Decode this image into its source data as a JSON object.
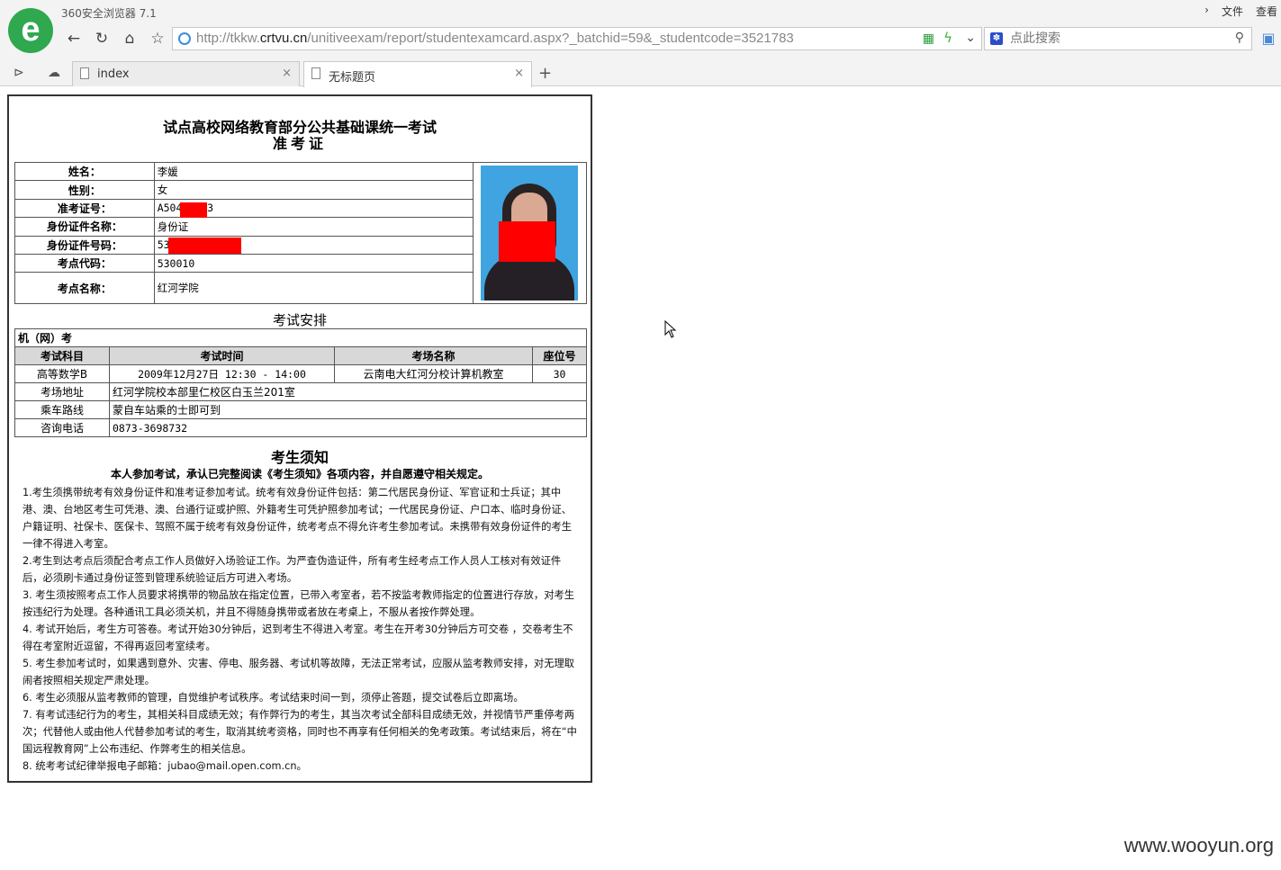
{
  "browser": {
    "app_title": "360安全浏览器 7.1",
    "menu": [
      "文件",
      "查看"
    ],
    "url_prefix": "http://tkkw.",
    "url_domain": "crtvu.cn",
    "url_path": "/unitiveexam/report/studentexamcard.aspx?_batchid=59&_studentcode=3521783",
    "search_placeholder": "点此搜索",
    "tabs": [
      {
        "label": "index"
      },
      {
        "label": "无标题页"
      }
    ]
  },
  "card": {
    "title1": "试点高校网络教育部分公共基础课统一考试",
    "title2": "准考证",
    "info": [
      {
        "key": "姓名：",
        "value": "李媛"
      },
      {
        "key": "性别：",
        "value": "女"
      },
      {
        "key": "准考证号：",
        "value": "A504    0023"
      },
      {
        "key": "身份证件名称：",
        "value": "身份证"
      },
      {
        "key": "身份证件号码：",
        "value": "53           31228"
      },
      {
        "key": "考点代码：",
        "value": "530010"
      },
      {
        "key": "考点名称：",
        "value": "红河学院"
      }
    ],
    "exam_section_title": "考试安排",
    "exam_type": "机（网）考",
    "exam_headers": [
      "考试科目",
      "考试时间",
      "考场名称",
      "座位号"
    ],
    "exam_row": [
      "高等数学B",
      "2009年12月27日 12:30 - 14:00",
      "云南电大红河分校计算机教室",
      "30"
    ],
    "extra_rows": [
      {
        "key": "考场地址",
        "value": "红河学院校本部里仁校区白玉兰201室"
      },
      {
        "key": "乘车路线",
        "value": "蒙自车站乘的士即可到"
      },
      {
        "key": "咨询电话",
        "value": "0873-3698732"
      }
    ],
    "notice_title": "考生须知",
    "notice_sub": "本人参加考试，承认已完整阅读《考生须知》各项内容，并自愿遵守相关规定。",
    "rules": [
      "1.考生须携带统考有效身份证件和准考证参加考试。统考有效身份证件包括：第二代居民身份证、军官证和士兵证；其中港、澳、台地区考生可凭港、澳、台通行证或护照、外籍考生可凭护照参加考试；一代居民身份证、户口本、临时身份证、户籍证明、社保卡、医保卡、驾照不属于统考有效身份证件，统考考点不得允许考生参加考试。未携带有效身份证件的考生一律不得进入考室。",
      "2.考生到达考点后须配合考点工作人员做好入场验证工作。为严查伪造证件，所有考生经考点工作人员人工核对有效证件后，必须刷卡通过身份证签到管理系统验证后方可进入考场。",
      "3. 考生须按照考点工作人员要求将携带的物品放在指定位置，已带入考室者，若不按监考教师指定的位置进行存放，对考生按违纪行为处理。各种通讯工具必须关机，并且不得随身携带或者放在考桌上，不服从者按作弊处理。",
      "4. 考试开始后，考生方可答卷。考试开始30分钟后，迟到考生不得进入考室。考生在开考30分钟后方可交卷 ，交卷考生不得在考室附近逗留，不得再返回考室续考。",
      "5. 考生参加考试时，如果遇到意外、灾害、停电、服务器、考试机等故障，无法正常考试，应服从监考教师安排，对无理取闹者按照相关规定严肃处理。",
      "6. 考生必须服从监考教师的管理，自觉维护考试秩序。考试结束时间一到，须停止答题，提交试卷后立即离场。",
      "7. 有考试违纪行为的考生，其相关科目成绩无效；有作弊行为的考生，其当次考试全部科目成绩无效，并视情节严重停考两次；代替他人或由他人代替参加考试的考生，取消其统考资格，同时也不再享有任何相关的免考政策。考试结束后，将在“中国远程教育网”上公布违纪、作弊考生的相关信息。",
      "8. 统考考试纪律举报电子邮箱：jubao@mail.open.com.cn。"
    ]
  },
  "watermark": "www.wooyun.org"
}
